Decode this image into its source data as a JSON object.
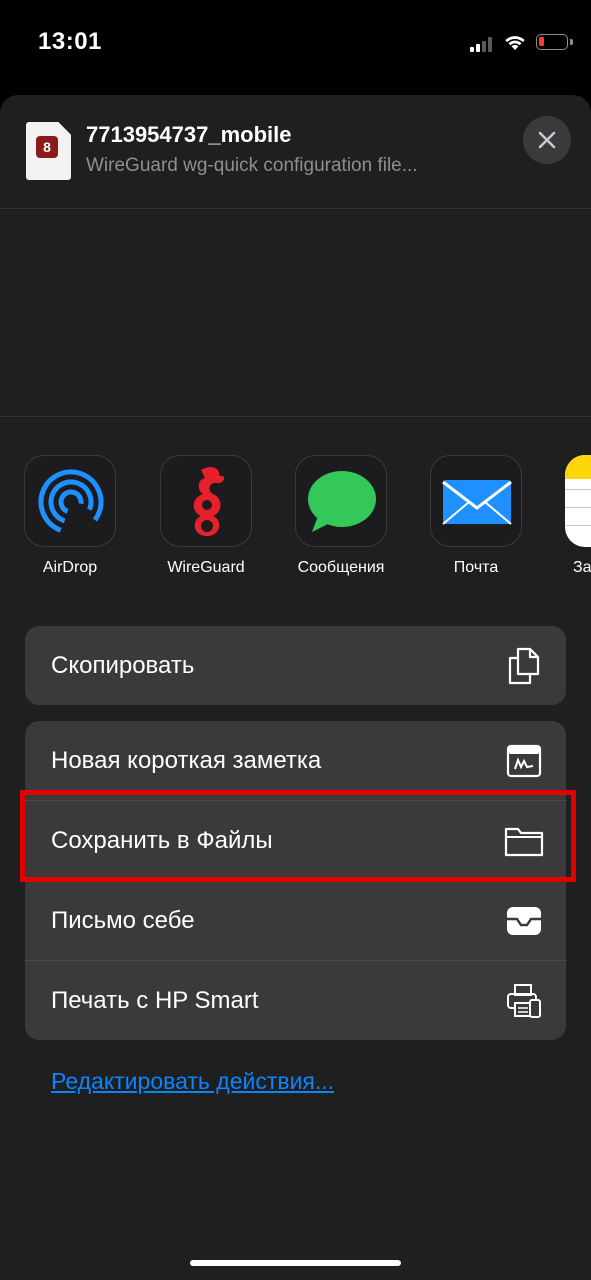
{
  "status_bar": {
    "time": "13:01",
    "battery_color": "#ff3b30"
  },
  "share_sheet": {
    "file_name": "7713954737_mobile",
    "file_subtitle": "WireGuard wg-quick configuration file...",
    "file_icon_letter": "8",
    "close_icon": "close-icon",
    "apps": [
      {
        "label": "AirDrop",
        "icon": "airdrop-icon"
      },
      {
        "label": "WireGuard",
        "icon": "wireguard-icon"
      },
      {
        "label": "Сообщения",
        "icon": "messages-icon"
      },
      {
        "label": "Почта",
        "icon": "mail-icon"
      },
      {
        "label": "За",
        "icon": "notes-icon"
      }
    ],
    "actions_group1": [
      {
        "label": "Скопировать",
        "icon": "copy-icon"
      }
    ],
    "actions_group2": [
      {
        "label": "Новая короткая заметка",
        "icon": "quick-note-icon"
      },
      {
        "label": "Сохранить в Файлы",
        "icon": "folder-icon"
      },
      {
        "label": "Письмо себе",
        "icon": "mail-tray-icon"
      },
      {
        "label": "Печать с HP Smart",
        "icon": "printer-icon"
      }
    ],
    "edit_actions_link": "Редактировать действия..."
  },
  "colors": {
    "accent": "#0a84ff",
    "highlight": "#e00000",
    "wireguard_red": "#e8202a"
  }
}
